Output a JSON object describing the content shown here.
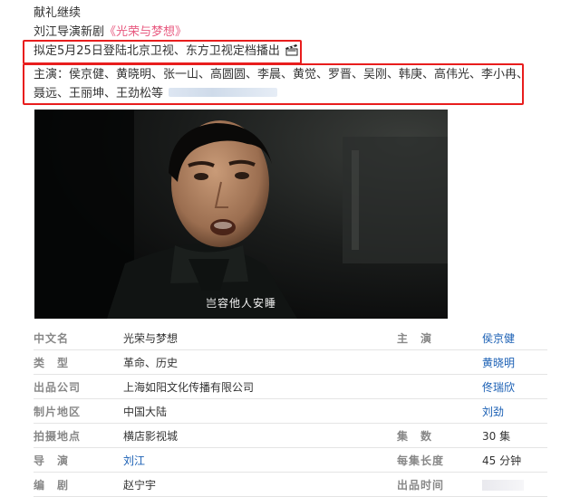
{
  "post": {
    "line1": "献礼继续",
    "line2_prefix": "刘江导演新剧",
    "line2_title": "《光荣与梦想》",
    "box1": "拟定5月25日登陆北京卫视、东方卫视定档播出",
    "box2_line1": "主演：侯京健、黄晓明、张一山、高圆圆、李晨、黄觉、罗晋、吴刚、韩庚、高伟光、李小冉、",
    "box2_line2": "聂远、王丽坤、王劲松等"
  },
  "video": {
    "subtitle": "岂容他人安睡"
  },
  "info_table": {
    "rows": [
      {
        "label": "中文名",
        "value": "光荣与梦想",
        "label2": "主　演",
        "value2": "侯京健"
      },
      {
        "label": "类　型",
        "value": "革命、历史",
        "label2": "",
        "value2": "黄晓明"
      },
      {
        "label": "出品公司",
        "value": "上海如阳文化传播有限公司",
        "label2": "",
        "value2": "佟瑞欣"
      },
      {
        "label": "制片地区",
        "value": "中国大陆",
        "label2": "",
        "value2": "刘劲"
      },
      {
        "label": "拍摄地点",
        "value": "横店影视城",
        "label2": "集　数",
        "value2": "30 集"
      },
      {
        "label": "导　演",
        "value": "刘江",
        "label2": "每集长度",
        "value2": "45 分钟"
      },
      {
        "label": "编　剧",
        "value": "赵宁宇",
        "label2": "出品时间",
        "value2": ""
      }
    ]
  },
  "colors": {
    "highlight_box": "#e81d1d",
    "link": "#1a5fb4",
    "title_pink": "#e8597f"
  }
}
